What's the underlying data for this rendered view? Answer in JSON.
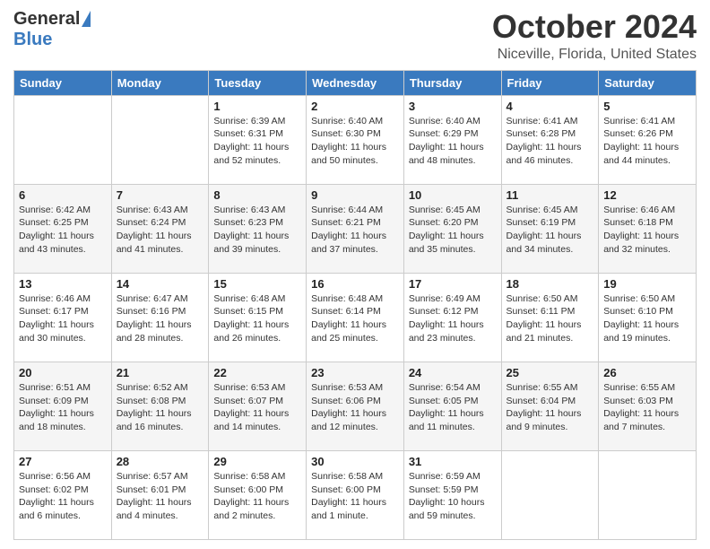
{
  "header": {
    "logo_general": "General",
    "logo_blue": "Blue",
    "title": "October 2024",
    "subtitle": "Niceville, Florida, United States"
  },
  "days_of_week": [
    "Sunday",
    "Monday",
    "Tuesday",
    "Wednesday",
    "Thursday",
    "Friday",
    "Saturday"
  ],
  "weeks": [
    [
      {
        "day": "",
        "info": ""
      },
      {
        "day": "",
        "info": ""
      },
      {
        "day": "1",
        "info": "Sunrise: 6:39 AM\nSunset: 6:31 PM\nDaylight: 11 hours and 52 minutes."
      },
      {
        "day": "2",
        "info": "Sunrise: 6:40 AM\nSunset: 6:30 PM\nDaylight: 11 hours and 50 minutes."
      },
      {
        "day": "3",
        "info": "Sunrise: 6:40 AM\nSunset: 6:29 PM\nDaylight: 11 hours and 48 minutes."
      },
      {
        "day": "4",
        "info": "Sunrise: 6:41 AM\nSunset: 6:28 PM\nDaylight: 11 hours and 46 minutes."
      },
      {
        "day": "5",
        "info": "Sunrise: 6:41 AM\nSunset: 6:26 PM\nDaylight: 11 hours and 44 minutes."
      }
    ],
    [
      {
        "day": "6",
        "info": "Sunrise: 6:42 AM\nSunset: 6:25 PM\nDaylight: 11 hours and 43 minutes."
      },
      {
        "day": "7",
        "info": "Sunrise: 6:43 AM\nSunset: 6:24 PM\nDaylight: 11 hours and 41 minutes."
      },
      {
        "day": "8",
        "info": "Sunrise: 6:43 AM\nSunset: 6:23 PM\nDaylight: 11 hours and 39 minutes."
      },
      {
        "day": "9",
        "info": "Sunrise: 6:44 AM\nSunset: 6:21 PM\nDaylight: 11 hours and 37 minutes."
      },
      {
        "day": "10",
        "info": "Sunrise: 6:45 AM\nSunset: 6:20 PM\nDaylight: 11 hours and 35 minutes."
      },
      {
        "day": "11",
        "info": "Sunrise: 6:45 AM\nSunset: 6:19 PM\nDaylight: 11 hours and 34 minutes."
      },
      {
        "day": "12",
        "info": "Sunrise: 6:46 AM\nSunset: 6:18 PM\nDaylight: 11 hours and 32 minutes."
      }
    ],
    [
      {
        "day": "13",
        "info": "Sunrise: 6:46 AM\nSunset: 6:17 PM\nDaylight: 11 hours and 30 minutes."
      },
      {
        "day": "14",
        "info": "Sunrise: 6:47 AM\nSunset: 6:16 PM\nDaylight: 11 hours and 28 minutes."
      },
      {
        "day": "15",
        "info": "Sunrise: 6:48 AM\nSunset: 6:15 PM\nDaylight: 11 hours and 26 minutes."
      },
      {
        "day": "16",
        "info": "Sunrise: 6:48 AM\nSunset: 6:14 PM\nDaylight: 11 hours and 25 minutes."
      },
      {
        "day": "17",
        "info": "Sunrise: 6:49 AM\nSunset: 6:12 PM\nDaylight: 11 hours and 23 minutes."
      },
      {
        "day": "18",
        "info": "Sunrise: 6:50 AM\nSunset: 6:11 PM\nDaylight: 11 hours and 21 minutes."
      },
      {
        "day": "19",
        "info": "Sunrise: 6:50 AM\nSunset: 6:10 PM\nDaylight: 11 hours and 19 minutes."
      }
    ],
    [
      {
        "day": "20",
        "info": "Sunrise: 6:51 AM\nSunset: 6:09 PM\nDaylight: 11 hours and 18 minutes."
      },
      {
        "day": "21",
        "info": "Sunrise: 6:52 AM\nSunset: 6:08 PM\nDaylight: 11 hours and 16 minutes."
      },
      {
        "day": "22",
        "info": "Sunrise: 6:53 AM\nSunset: 6:07 PM\nDaylight: 11 hours and 14 minutes."
      },
      {
        "day": "23",
        "info": "Sunrise: 6:53 AM\nSunset: 6:06 PM\nDaylight: 11 hours and 12 minutes."
      },
      {
        "day": "24",
        "info": "Sunrise: 6:54 AM\nSunset: 6:05 PM\nDaylight: 11 hours and 11 minutes."
      },
      {
        "day": "25",
        "info": "Sunrise: 6:55 AM\nSunset: 6:04 PM\nDaylight: 11 hours and 9 minutes."
      },
      {
        "day": "26",
        "info": "Sunrise: 6:55 AM\nSunset: 6:03 PM\nDaylight: 11 hours and 7 minutes."
      }
    ],
    [
      {
        "day": "27",
        "info": "Sunrise: 6:56 AM\nSunset: 6:02 PM\nDaylight: 11 hours and 6 minutes."
      },
      {
        "day": "28",
        "info": "Sunrise: 6:57 AM\nSunset: 6:01 PM\nDaylight: 11 hours and 4 minutes."
      },
      {
        "day": "29",
        "info": "Sunrise: 6:58 AM\nSunset: 6:00 PM\nDaylight: 11 hours and 2 minutes."
      },
      {
        "day": "30",
        "info": "Sunrise: 6:58 AM\nSunset: 6:00 PM\nDaylight: 11 hours and 1 minute."
      },
      {
        "day": "31",
        "info": "Sunrise: 6:59 AM\nSunset: 5:59 PM\nDaylight: 10 hours and 59 minutes."
      },
      {
        "day": "",
        "info": ""
      },
      {
        "day": "",
        "info": ""
      }
    ]
  ]
}
